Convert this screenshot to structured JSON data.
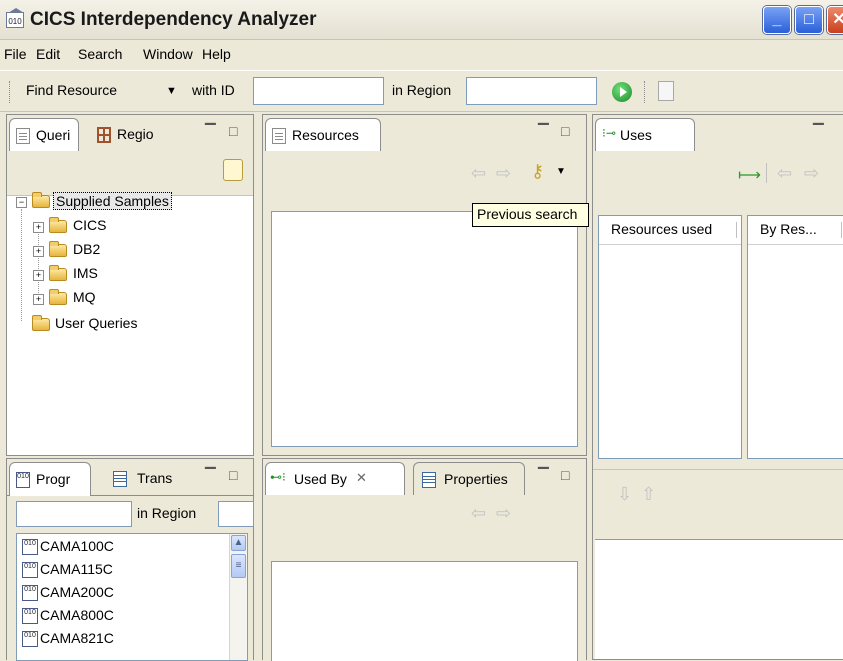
{
  "window": {
    "title": "CICS Interdependency Analyzer"
  },
  "menubar": [
    "File",
    "Edit",
    "Search",
    "Window",
    "Help"
  ],
  "toolbar": {
    "find_resource_label": "Find Resource",
    "with_id_label": "with ID",
    "with_id_value": "",
    "in_region_label": "in Region",
    "in_region_value": ""
  },
  "queries_panel": {
    "tabs": [
      {
        "label": "Queri",
        "icon": "document-icon",
        "active": true
      },
      {
        "label": "Regio",
        "icon": "grid-icon",
        "active": false
      }
    ],
    "tree": [
      {
        "label": "Supplied Samples",
        "expanded": true,
        "selected": true
      },
      {
        "label": "CICS",
        "expanded": false
      },
      {
        "label": "DB2",
        "expanded": false
      },
      {
        "label": "IMS",
        "expanded": false
      },
      {
        "label": "MQ",
        "expanded": false
      },
      {
        "label": "User Queries",
        "expanded": false
      }
    ]
  },
  "resources_panel": {
    "tab": "Resources",
    "tooltip": "Previous search"
  },
  "uses_panel": {
    "tab": "Uses",
    "columns": [
      "Resources used",
      "By Res..."
    ]
  },
  "programs_panel": {
    "tabs": [
      {
        "label": "Progr",
        "icon": "binary-icon",
        "active": true
      },
      {
        "label": "Trans",
        "icon": "table-icon",
        "active": false
      }
    ],
    "filter_value": "",
    "in_region_label": "in Region",
    "items": [
      "CAMA100C",
      "CAMA115C",
      "CAMA200C",
      "CAMA800C",
      "CAMA821C"
    ]
  },
  "usedby_panel": {
    "tabs": [
      {
        "label": "Used By",
        "active": true
      },
      {
        "label": "Properties",
        "active": false
      }
    ]
  },
  "binary_icon_text": "010"
}
